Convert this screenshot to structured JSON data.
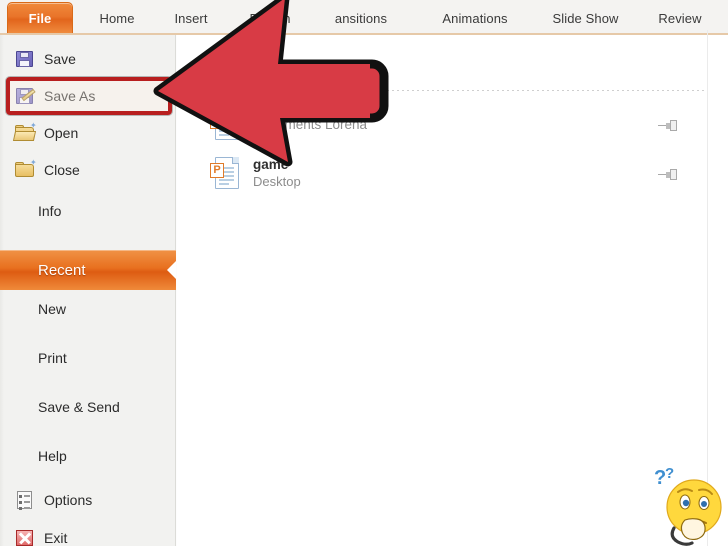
{
  "window": {
    "app": "PowerPoint 2010 Backstage",
    "accent_orange": "#e8701f",
    "highlight_red": "#b81f1f",
    "arrow_red": "#d83b45"
  },
  "ribbon": {
    "tabs": [
      {
        "label": "File",
        "active": true,
        "icon": "file-tab"
      },
      {
        "label": "Home",
        "active": false
      },
      {
        "label": "Insert",
        "active": false
      },
      {
        "label": "Design",
        "active": false
      },
      {
        "label": "Transitions",
        "active": false,
        "visible_text": "ansitions"
      },
      {
        "label": "Animations",
        "active": false
      },
      {
        "label": "Slide Show",
        "active": false
      },
      {
        "label": "Review",
        "active": false
      }
    ]
  },
  "sidebar": {
    "items": [
      {
        "label": "Save",
        "icon": "floppy-disk-icon",
        "type": "command"
      },
      {
        "label": "Save As",
        "icon": "floppy-pencil-icon",
        "type": "command",
        "highlighted": true
      },
      {
        "label": "Open",
        "icon": "folder-open-icon",
        "type": "command"
      },
      {
        "label": "Close",
        "icon": "folder-close-icon",
        "type": "command"
      },
      {
        "label": "Info",
        "icon": "none",
        "type": "page"
      },
      {
        "label": "Recent",
        "icon": "none",
        "type": "page",
        "selected": true
      },
      {
        "label": "New",
        "icon": "none",
        "type": "page"
      },
      {
        "label": "Print",
        "icon": "none",
        "type": "page"
      },
      {
        "label": "Save & Send",
        "icon": "none",
        "type": "page"
      },
      {
        "label": "Help",
        "icon": "none",
        "type": "page"
      },
      {
        "label": "Options",
        "icon": "options-icon",
        "type": "command"
      },
      {
        "label": "Exit",
        "icon": "exit-x-icon",
        "type": "command"
      }
    ]
  },
  "recent_panel": {
    "files": [
      {
        "title": "",
        "location": "Documents Lorena",
        "icon": "powerpoint-doc-icon",
        "pin": "pushpin-icon"
      },
      {
        "title": "game",
        "location": "Desktop",
        "icon": "powerpoint-doc-icon",
        "pin": "pushpin-icon"
      }
    ]
  },
  "annotation": {
    "arrow": "red-arrow-pointing-left",
    "arrow_color": "#d83b45",
    "arrow_outline": "#111111",
    "highlight_box_target": "Save As"
  },
  "watermark": {
    "emoji": "thinking-face-emoji",
    "question_marks": "??"
  }
}
